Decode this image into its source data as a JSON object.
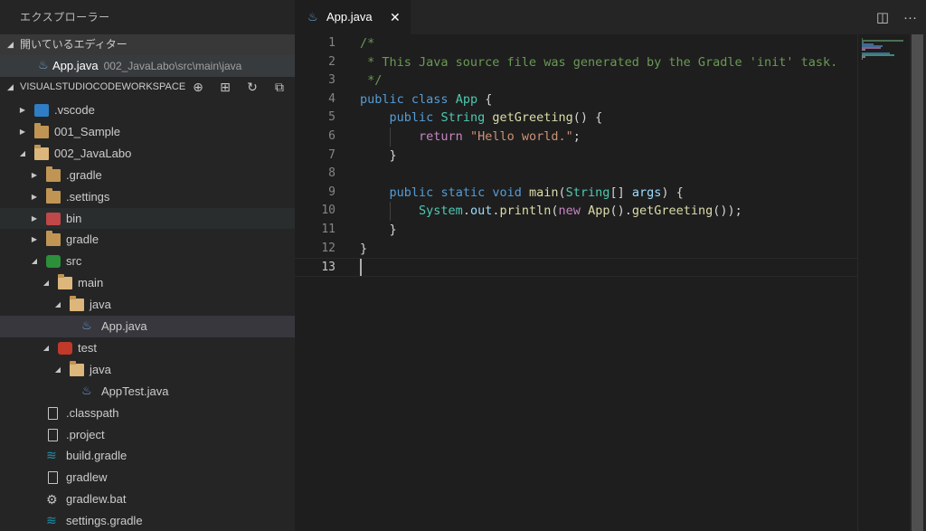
{
  "sidebar": {
    "title": "エクスプローラー",
    "open_editors_header": "開いているエディター",
    "open_editor": {
      "name": "App.java",
      "path": "002_JavaLabo\\src\\main\\java"
    },
    "workspace_header": "VISUALSTUDIOCODEWORKSPACE",
    "workspace_actions": [
      "new-file-icon",
      "new-folder-icon",
      "refresh-icon",
      "collapse-all-icon"
    ],
    "tree": [
      {
        "label": ".vscode",
        "depth": 0,
        "kind": "vscode",
        "twisty": "closed"
      },
      {
        "label": "001_Sample",
        "depth": 0,
        "kind": "folder",
        "twisty": "closed"
      },
      {
        "label": "002_JavaLabo",
        "depth": 0,
        "kind": "folder-open",
        "twisty": "open"
      },
      {
        "label": ".gradle",
        "depth": 1,
        "kind": "folder",
        "twisty": "closed"
      },
      {
        "label": ".settings",
        "depth": 1,
        "kind": "folder",
        "twisty": "closed"
      },
      {
        "label": "bin",
        "depth": 1,
        "kind": "bin",
        "twisty": "closed"
      },
      {
        "label": "gradle",
        "depth": 1,
        "kind": "folder",
        "twisty": "closed"
      },
      {
        "label": "src",
        "depth": 1,
        "kind": "src",
        "twisty": "open"
      },
      {
        "label": "main",
        "depth": 2,
        "kind": "folder-open",
        "twisty": "open"
      },
      {
        "label": "java",
        "depth": 3,
        "kind": "folder-open",
        "twisty": "open"
      },
      {
        "label": "App.java",
        "depth": 4,
        "kind": "java",
        "twisty": "none"
      },
      {
        "label": "test",
        "depth": 2,
        "kind": "test",
        "twisty": "open"
      },
      {
        "label": "java",
        "depth": 3,
        "kind": "folder-open",
        "twisty": "open"
      },
      {
        "label": "AppTest.java",
        "depth": 4,
        "kind": "java",
        "twisty": "none"
      },
      {
        "label": ".classpath",
        "depth": 1,
        "kind": "file",
        "twisty": "none"
      },
      {
        "label": ".project",
        "depth": 1,
        "kind": "file",
        "twisty": "none"
      },
      {
        "label": "build.gradle",
        "depth": 1,
        "kind": "gradle",
        "twisty": "none"
      },
      {
        "label": "gradlew",
        "depth": 1,
        "kind": "file",
        "twisty": "none"
      },
      {
        "label": "gradlew.bat",
        "depth": 1,
        "kind": "gear",
        "twisty": "none"
      },
      {
        "label": "settings.gradle",
        "depth": 1,
        "kind": "gradle",
        "twisty": "none"
      }
    ],
    "selected_index": 10,
    "hover_index": 5
  },
  "editor": {
    "tab": {
      "label": "App.java",
      "close": "✕"
    },
    "actions": [
      "split-editor-icon",
      "more-actions-icon"
    ],
    "lines": [
      {
        "n": "1",
        "tokens": [
          [
            "cm",
            "/*"
          ]
        ]
      },
      {
        "n": "2",
        "tokens": [
          [
            "cm",
            " * This Java source file was generated by the Gradle 'init' task."
          ]
        ]
      },
      {
        "n": "3",
        "tokens": [
          [
            "cm",
            " */"
          ]
        ]
      },
      {
        "n": "4",
        "tokens": [
          [
            "kw",
            "public"
          ],
          [
            "",
            " "
          ],
          [
            "kw",
            "class"
          ],
          [
            "",
            " "
          ],
          [
            "ty",
            "App"
          ],
          [
            "",
            " {"
          ]
        ]
      },
      {
        "n": "5",
        "tokens": [
          [
            "",
            "    "
          ],
          [
            "kw",
            "public"
          ],
          [
            "",
            " "
          ],
          [
            "ty",
            "String"
          ],
          [
            "",
            " "
          ],
          [
            "fn",
            "getGreeting"
          ],
          [
            "",
            "() {"
          ]
        ]
      },
      {
        "n": "6",
        "tokens": [
          [
            "",
            "        "
          ],
          [
            "ctl",
            "return"
          ],
          [
            "",
            " "
          ],
          [
            "str",
            "\"Hello world.\""
          ],
          [
            "",
            ";"
          ]
        ]
      },
      {
        "n": "7",
        "tokens": [
          [
            "",
            "    }"
          ]
        ]
      },
      {
        "n": "8",
        "tokens": []
      },
      {
        "n": "9",
        "tokens": [
          [
            "",
            "    "
          ],
          [
            "kw",
            "public"
          ],
          [
            "",
            " "
          ],
          [
            "kw",
            "static"
          ],
          [
            "",
            " "
          ],
          [
            "kw",
            "void"
          ],
          [
            "",
            " "
          ],
          [
            "fn",
            "main"
          ],
          [
            "",
            "("
          ],
          [
            "ty",
            "String"
          ],
          [
            "",
            "[] "
          ],
          [
            "var",
            "args"
          ],
          [
            "",
            ") {"
          ]
        ]
      },
      {
        "n": "10",
        "tokens": [
          [
            "",
            "        "
          ],
          [
            "ty",
            "System"
          ],
          [
            "",
            "."
          ],
          [
            "var",
            "out"
          ],
          [
            "",
            "."
          ],
          [
            "fn",
            "println"
          ],
          [
            "",
            "("
          ],
          [
            "ctl",
            "new"
          ],
          [
            "",
            " "
          ],
          [
            "fn",
            "App"
          ],
          [
            "",
            "()."
          ],
          [
            "fn",
            "getGreeting"
          ],
          [
            "",
            "());"
          ]
        ]
      },
      {
        "n": "11",
        "tokens": [
          [
            "",
            "    }"
          ]
        ]
      },
      {
        "n": "12",
        "tokens": [
          [
            "",
            "}"
          ]
        ]
      },
      {
        "n": "13",
        "tokens": []
      }
    ],
    "current_line": 13
  },
  "colors": {
    "sidebar_bg": "#252526",
    "editor_bg": "#1e1e1e",
    "comment": "#6a9955",
    "keyword": "#569cd6",
    "type": "#4ec9b0",
    "function": "#dcdcaa",
    "control": "#c586c0",
    "string": "#ce9178",
    "variable": "#9cdcfe"
  }
}
